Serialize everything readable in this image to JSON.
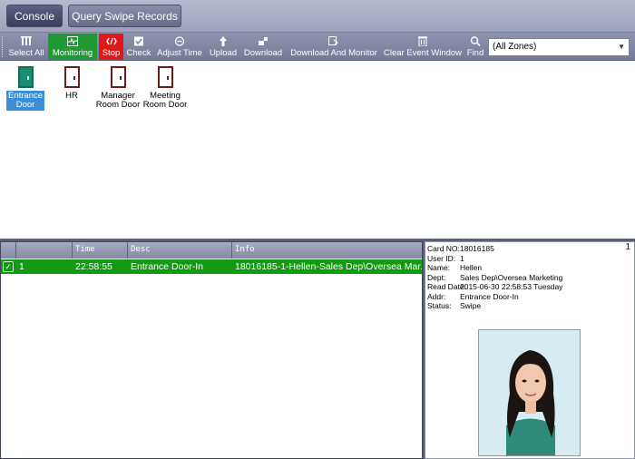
{
  "tabs": [
    {
      "label": "Console"
    },
    {
      "label": "Query Swipe Records"
    }
  ],
  "toolbar": {
    "buttons": [
      {
        "label": "Select All",
        "icon": "select-all-icon"
      },
      {
        "label": "Monitoring",
        "icon": "monitoring-icon"
      },
      {
        "label": "Stop",
        "icon": "stop-icon"
      },
      {
        "label": "Check",
        "icon": "check-icon"
      },
      {
        "label": "Adjust Time",
        "icon": "clock-icon"
      },
      {
        "label": "Upload",
        "icon": "upload-icon"
      },
      {
        "label": "Download",
        "icon": "download-icon"
      },
      {
        "label": "Download And Monitor",
        "icon": "download-monitor-icon"
      },
      {
        "label": "Clear Event Window",
        "icon": "trash-icon"
      },
      {
        "label": "Find",
        "icon": "search-icon"
      }
    ],
    "zone_select": "(All Zones)"
  },
  "doors": [
    {
      "label_line1": "Entrance",
      "label_line2": "Door",
      "active": true
    },
    {
      "label_line1": "HR",
      "label_line2": "",
      "active": false
    },
    {
      "label_line1": "Manager",
      "label_line2": "Room  Door",
      "active": false
    },
    {
      "label_line1": "Meeting",
      "label_line2": "Room Door",
      "active": false
    }
  ],
  "grid": {
    "headers": [
      "",
      "",
      "Time",
      "Desc",
      "Info"
    ],
    "rows": [
      {
        "no": "1",
        "time": "22:58:55",
        "desc": "Entrance Door-In",
        "info": "18016185-1-Hellen-Sales Dep\\Oversea Mar..."
      }
    ]
  },
  "detail": {
    "count": "1",
    "fields": [
      {
        "key": "Card NO:",
        "value": "18016185"
      },
      {
        "key": "User ID:",
        "value": "1"
      },
      {
        "key": "Name:",
        "value": "Hellen"
      },
      {
        "key": "Dept:",
        "value": "Sales Dep\\Oversea Marketing"
      },
      {
        "key": "Read Date:",
        "value": "2015-06-30 22:58:53 Tuesday"
      },
      {
        "key": "Addr:",
        "value": "Entrance Door-In"
      },
      {
        "key": "Status:",
        "value": "Swipe"
      }
    ]
  },
  "colors": {
    "monitoring": "#1f9a33",
    "stop": "#e01818",
    "selected_row": "#129a12",
    "active_door": "#1b8c73"
  }
}
